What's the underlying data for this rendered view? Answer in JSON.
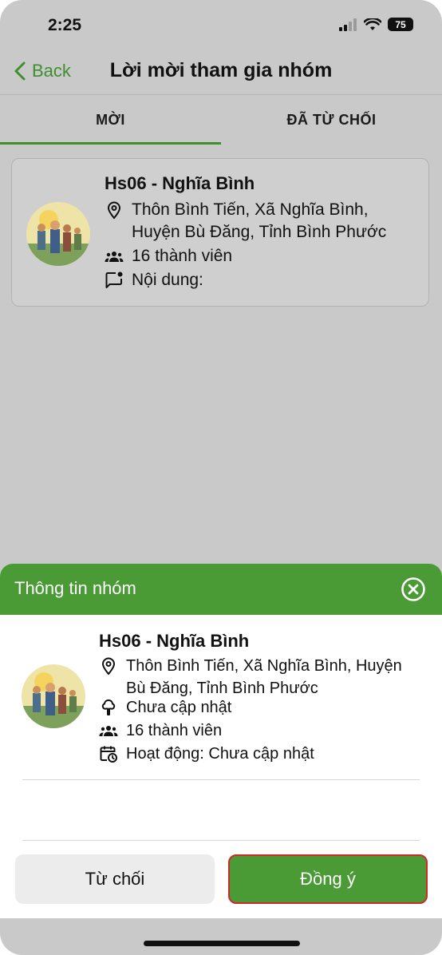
{
  "status": {
    "time": "2:25",
    "battery": "75"
  },
  "nav": {
    "back_label": "Back",
    "title": "Lời mời tham gia nhóm"
  },
  "tabs": [
    {
      "label": "MỜI"
    },
    {
      "label": "ĐÃ TỪ CHỐI"
    }
  ],
  "invite_card": {
    "name": "Hs06 - Nghĩa Bình",
    "address_line1": "Thôn Bình Tiến, Xã Nghĩa Bình,",
    "address_line2": "Huyện Bù Đăng, Tỉnh Bình Phước",
    "members": "16 thành viên",
    "content": "Nội dung:"
  },
  "sheet": {
    "title": "Thông tin nhóm",
    "name": "Hs06 - Nghĩa Bình",
    "address_line1": "Thôn Bình Tiến, Xã Nghĩa Bình, Huyện",
    "address_line2": "Bù Đăng, Tỉnh Bình Phước",
    "crop": "Chưa cập nhật",
    "members": "16 thành viên",
    "activity": "Hoạt động: Chưa cập nhật",
    "reject_label": "Từ chối",
    "accept_label": "Đồng ý"
  },
  "colors": {
    "accent": "#4a9a36",
    "accent_text": "#3f8f2c"
  }
}
